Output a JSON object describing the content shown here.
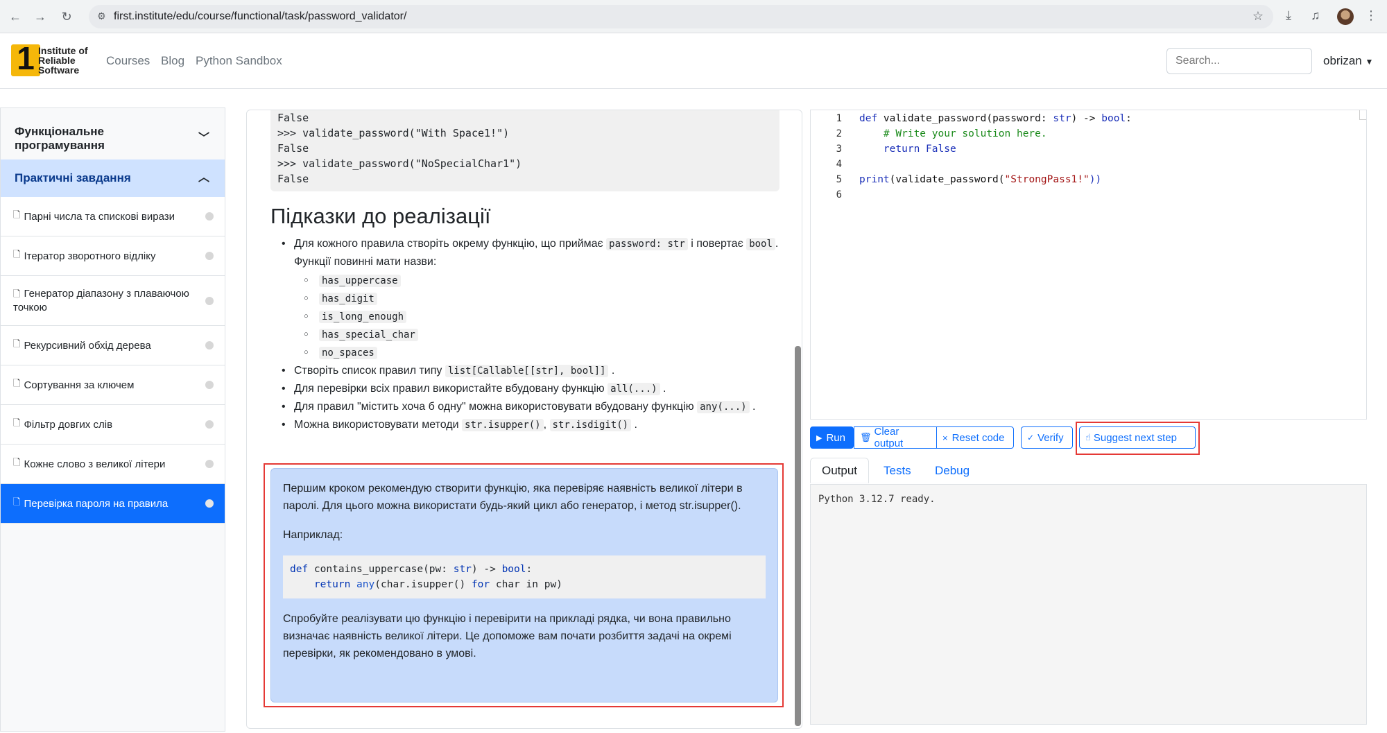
{
  "browser": {
    "url": "first.institute/edu/course/functional/task/password_validator/"
  },
  "site": {
    "logo_number": "1",
    "logo_line1": "Institute of",
    "logo_line2": "Reliable",
    "logo_line3": "Software",
    "nav": [
      "Courses",
      "Blog",
      "Python Sandbox"
    ],
    "search_placeholder": "Search...",
    "username": "obrizan"
  },
  "sidebar": {
    "section1": "Функціональне програмування",
    "section2": "Практичні завдання",
    "tasks": [
      "Парні числа та спискові вирази",
      "Ітератор зворотного відліку",
      "Генератор діапазону з плаваючою точкою",
      "Рекурсивний обхід дерева",
      "Сортування за ключем",
      "Фільтр довгих слів",
      "Кожне слово з великої літери",
      "Перевірка пароля на правила"
    ]
  },
  "doc": {
    "code_lines": [
      "False",
      ">>> validate_password(\"With Space1!\")",
      "False",
      ">>> validate_password(\"NoSpecialChar1\")",
      "False"
    ],
    "hints_title": "Підказки до реалізації",
    "b1_a": "Для кожного правила створіть окрему функцію, що приймає",
    "b1_code1": "password: str",
    "b1_b": "і повертає",
    "b1_code2": "bool",
    "b1_c": ". Функції повинні мати назви:",
    "funcs": [
      "has_uppercase",
      "has_digit",
      "is_long_enough",
      "has_special_char",
      "no_spaces"
    ],
    "b2_a": "Створіть список правил типу",
    "b2_code": "list[Callable[[str], bool]]",
    "b2_b": ".",
    "b3_a": "Для перевірки всіх правил використайте вбудовану функцію",
    "b3_code": "all(...)",
    "b3_b": ".",
    "b4_a": "Для правил \"містить хоча б одну\" можна використовувати вбудовану функцію",
    "b4_code": "any(...)",
    "b4_b": ".",
    "b5_a": "Можна використовувати методи",
    "b5_code1": "str.isupper()",
    "b5_sep": ",",
    "b5_code2": "str.isdigit()",
    "b5_b": "."
  },
  "suggestion": {
    "p1": "Першим кроком рекомендую створити функцію, яка перевіряє наявність великої літери в паролі. Для цього можна використати будь-який цикл або генератор, і метод str.isupper().",
    "p2": "Наприклад:",
    "code1_kw": "def",
    "code1_name": " contains_uppercase(pw: ",
    "code1_type": "str",
    "code1_arrow": ") -> ",
    "code1_ret": "bool",
    "code1_end": ":",
    "code2_indent": "    ",
    "code2_kw": "return",
    "code2_sp": " ",
    "code2_any": "any",
    "code2_mid": "(char.isupper() ",
    "code2_for": "for",
    "code2_end": " char in pw)",
    "p3": "Спробуйте реалізувати цю функцію і перевірити на прикладі рядка, чи вона правильно визначає наявність великої літери. Це допоможе вам почати розбиття задачі на окремі перевірки, як рекомендовано в умові."
  },
  "editor": {
    "line_numbers": [
      "1",
      "2",
      "3",
      "4",
      "5",
      "6"
    ],
    "l1_kw": "def",
    "l1_a": " validate_password(password: ",
    "l1_type": "str",
    "l1_b": ") -> ",
    "l1_ret": "bool",
    "l1_c": ":",
    "l2": "    # Write your solution here.",
    "l3_indent": "    ",
    "l3_kw": "return",
    "l3_sp": " ",
    "l3_val": "False",
    "l5_fn": "print",
    "l5_a": "(validate_password(",
    "l5_str": "\"StrongPass1!\"",
    "l5_b": "))"
  },
  "toolbar": {
    "run": "Run",
    "clear": "Clear output",
    "reset": "Reset code",
    "verify": "Verify",
    "suggest": "Suggest next step"
  },
  "output_tabs": [
    "Output",
    "Tests",
    "Debug"
  ],
  "output_text": "Python 3.12.7 ready.",
  "colors": {
    "accent": "#0d6efd",
    "highlight": "#e53935",
    "suggestion_bg": "#c7dbfb"
  }
}
